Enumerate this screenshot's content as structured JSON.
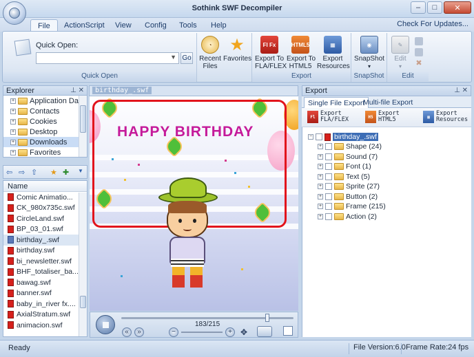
{
  "window": {
    "title": "Sothink SWF Decompiler"
  },
  "ribbon": {
    "tabs": [
      "File",
      "ActionScript",
      "View",
      "Config",
      "Tools",
      "Help"
    ],
    "check_updates": "Check For Updates...",
    "quick_open": {
      "label": "Quick Open:",
      "value": "",
      "go": "Go",
      "group": "Quick Open"
    },
    "recent_files": "Recent\nFiles",
    "favorites": "Favorites",
    "export_fla": "Export To\nFLA/FLEX",
    "export_html5": "Export To\nHTML5",
    "export_resources": "Export\nResources",
    "export_group": "Export",
    "snapshot": "SnapShot",
    "snapshot_group": "SnapShot",
    "edit": "Edit",
    "edit_group": "Edit"
  },
  "explorer": {
    "title": "Explorer",
    "folders": [
      "Application Dat",
      "Contacts",
      "Cookies",
      "Desktop",
      "Downloads",
      "Favorites"
    ],
    "list_header": "Name",
    "files": [
      "Comic Animatio...",
      "CK_980x735c.swf",
      "CircleLand.swf",
      "BP_03_01.swf",
      "birthday_.swf",
      "birthday.swf",
      "bi_newsletter.swf",
      "BHF_totaliser_ba...",
      "bawag.swf",
      "banner.swf",
      "baby_in_river fx....",
      "AxialStratum.swf",
      "animacion.swf"
    ],
    "selected_file": "birthday_.swf"
  },
  "preview": {
    "tab": "birthday_.swf",
    "banner_text": "HAPPY  BIRTHDAY",
    "frame": "183/215",
    "current_frame": 183,
    "total_frames": 215
  },
  "export": {
    "title": "Export",
    "tabs": [
      "Single File Export",
      "Multi-file Export"
    ],
    "tools": [
      {
        "line1": "Export",
        "line2": "FLA/FLEX"
      },
      {
        "line1": "Export",
        "line2": "HTML5"
      },
      {
        "line1": "Export",
        "line2": "Resources"
      }
    ],
    "root": "birthday_.swf",
    "items": [
      "Shape (24)",
      "Sound (7)",
      "Font (1)",
      "Text (5)",
      "Sprite (27)",
      "Button (2)",
      "Frame (215)",
      "Action (2)"
    ]
  },
  "status": {
    "left": "Ready",
    "version": "File Version:6.0",
    "frame_rate": "Frame Rate:24 fps"
  },
  "colors": {
    "accent": "#3d6db5",
    "banner_text": "#c51a9a",
    "frame_border": "#e2141c"
  }
}
